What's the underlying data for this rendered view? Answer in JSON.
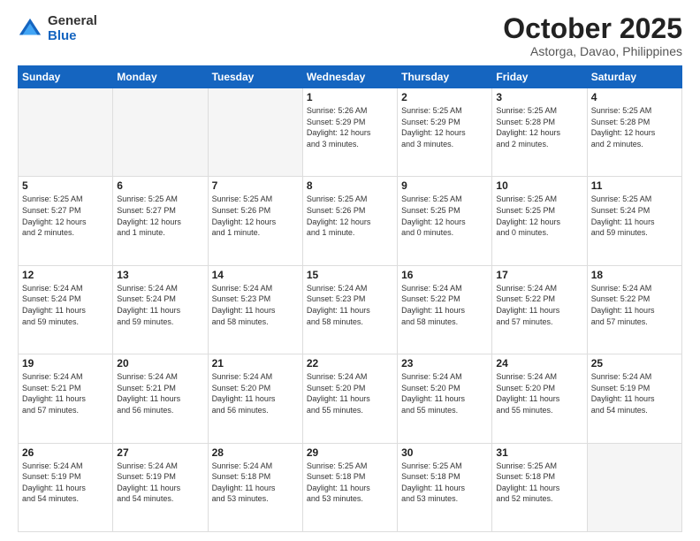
{
  "logo": {
    "general": "General",
    "blue": "Blue"
  },
  "header": {
    "month": "October 2025",
    "location": "Astorga, Davao, Philippines"
  },
  "weekdays": [
    "Sunday",
    "Monday",
    "Tuesday",
    "Wednesday",
    "Thursday",
    "Friday",
    "Saturday"
  ],
  "weeks": [
    [
      {
        "day": "",
        "info": ""
      },
      {
        "day": "",
        "info": ""
      },
      {
        "day": "",
        "info": ""
      },
      {
        "day": "1",
        "info": "Sunrise: 5:26 AM\nSunset: 5:29 PM\nDaylight: 12 hours\nand 3 minutes."
      },
      {
        "day": "2",
        "info": "Sunrise: 5:25 AM\nSunset: 5:29 PM\nDaylight: 12 hours\nand 3 minutes."
      },
      {
        "day": "3",
        "info": "Sunrise: 5:25 AM\nSunset: 5:28 PM\nDaylight: 12 hours\nand 2 minutes."
      },
      {
        "day": "4",
        "info": "Sunrise: 5:25 AM\nSunset: 5:28 PM\nDaylight: 12 hours\nand 2 minutes."
      }
    ],
    [
      {
        "day": "5",
        "info": "Sunrise: 5:25 AM\nSunset: 5:27 PM\nDaylight: 12 hours\nand 2 minutes."
      },
      {
        "day": "6",
        "info": "Sunrise: 5:25 AM\nSunset: 5:27 PM\nDaylight: 12 hours\nand 1 minute."
      },
      {
        "day": "7",
        "info": "Sunrise: 5:25 AM\nSunset: 5:26 PM\nDaylight: 12 hours\nand 1 minute."
      },
      {
        "day": "8",
        "info": "Sunrise: 5:25 AM\nSunset: 5:26 PM\nDaylight: 12 hours\nand 1 minute."
      },
      {
        "day": "9",
        "info": "Sunrise: 5:25 AM\nSunset: 5:25 PM\nDaylight: 12 hours\nand 0 minutes."
      },
      {
        "day": "10",
        "info": "Sunrise: 5:25 AM\nSunset: 5:25 PM\nDaylight: 12 hours\nand 0 minutes."
      },
      {
        "day": "11",
        "info": "Sunrise: 5:25 AM\nSunset: 5:24 PM\nDaylight: 11 hours\nand 59 minutes."
      }
    ],
    [
      {
        "day": "12",
        "info": "Sunrise: 5:24 AM\nSunset: 5:24 PM\nDaylight: 11 hours\nand 59 minutes."
      },
      {
        "day": "13",
        "info": "Sunrise: 5:24 AM\nSunset: 5:24 PM\nDaylight: 11 hours\nand 59 minutes."
      },
      {
        "day": "14",
        "info": "Sunrise: 5:24 AM\nSunset: 5:23 PM\nDaylight: 11 hours\nand 58 minutes."
      },
      {
        "day": "15",
        "info": "Sunrise: 5:24 AM\nSunset: 5:23 PM\nDaylight: 11 hours\nand 58 minutes."
      },
      {
        "day": "16",
        "info": "Sunrise: 5:24 AM\nSunset: 5:22 PM\nDaylight: 11 hours\nand 58 minutes."
      },
      {
        "day": "17",
        "info": "Sunrise: 5:24 AM\nSunset: 5:22 PM\nDaylight: 11 hours\nand 57 minutes."
      },
      {
        "day": "18",
        "info": "Sunrise: 5:24 AM\nSunset: 5:22 PM\nDaylight: 11 hours\nand 57 minutes."
      }
    ],
    [
      {
        "day": "19",
        "info": "Sunrise: 5:24 AM\nSunset: 5:21 PM\nDaylight: 11 hours\nand 57 minutes."
      },
      {
        "day": "20",
        "info": "Sunrise: 5:24 AM\nSunset: 5:21 PM\nDaylight: 11 hours\nand 56 minutes."
      },
      {
        "day": "21",
        "info": "Sunrise: 5:24 AM\nSunset: 5:20 PM\nDaylight: 11 hours\nand 56 minutes."
      },
      {
        "day": "22",
        "info": "Sunrise: 5:24 AM\nSunset: 5:20 PM\nDaylight: 11 hours\nand 55 minutes."
      },
      {
        "day": "23",
        "info": "Sunrise: 5:24 AM\nSunset: 5:20 PM\nDaylight: 11 hours\nand 55 minutes."
      },
      {
        "day": "24",
        "info": "Sunrise: 5:24 AM\nSunset: 5:20 PM\nDaylight: 11 hours\nand 55 minutes."
      },
      {
        "day": "25",
        "info": "Sunrise: 5:24 AM\nSunset: 5:19 PM\nDaylight: 11 hours\nand 54 minutes."
      }
    ],
    [
      {
        "day": "26",
        "info": "Sunrise: 5:24 AM\nSunset: 5:19 PM\nDaylight: 11 hours\nand 54 minutes."
      },
      {
        "day": "27",
        "info": "Sunrise: 5:24 AM\nSunset: 5:19 PM\nDaylight: 11 hours\nand 54 minutes."
      },
      {
        "day": "28",
        "info": "Sunrise: 5:24 AM\nSunset: 5:18 PM\nDaylight: 11 hours\nand 53 minutes."
      },
      {
        "day": "29",
        "info": "Sunrise: 5:25 AM\nSunset: 5:18 PM\nDaylight: 11 hours\nand 53 minutes."
      },
      {
        "day": "30",
        "info": "Sunrise: 5:25 AM\nSunset: 5:18 PM\nDaylight: 11 hours\nand 53 minutes."
      },
      {
        "day": "31",
        "info": "Sunrise: 5:25 AM\nSunset: 5:18 PM\nDaylight: 11 hours\nand 52 minutes."
      },
      {
        "day": "",
        "info": ""
      }
    ]
  ]
}
